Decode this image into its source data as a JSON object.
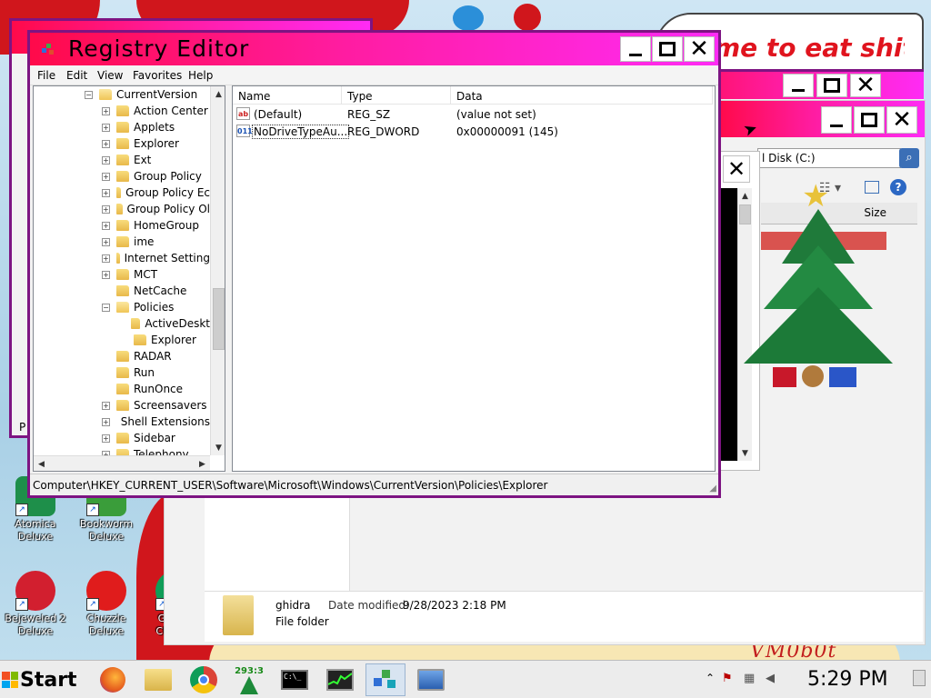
{
  "desktop": {
    "speech_text": "me to eat shit",
    "watermark": "VM0b0t",
    "icons": [
      {
        "line1": "Atomica",
        "line2": "Deluxe"
      },
      {
        "line1": "Bookworm",
        "line2": "Deluxe"
      },
      {
        "line1": "Bejeweled 2",
        "line2": "Deluxe"
      },
      {
        "line1": "Chuzzle",
        "line2": "Deluxe"
      },
      {
        "line1": "Google",
        "line2": "Chrome"
      }
    ]
  },
  "explorer": {
    "address": "l Disk (C:)",
    "column_size": "Size",
    "status_name": "ghidra",
    "status_modified_label": "Date modified:",
    "status_modified_value": "9/28/2023 2:18 PM",
    "status_type": "File folder",
    "left_letter": "P"
  },
  "regedit": {
    "title": "Registry Editor",
    "menu": [
      "File",
      "Edit",
      "View",
      "Favorites",
      "Help"
    ],
    "tree": [
      {
        "label": "CurrentVersion",
        "expander": "−",
        "level": 0
      },
      {
        "label": "Action Center",
        "expander": "+",
        "level": 1
      },
      {
        "label": "Applets",
        "expander": "+",
        "level": 1
      },
      {
        "label": "Explorer",
        "expander": "+",
        "level": 1
      },
      {
        "label": "Ext",
        "expander": "+",
        "level": 1
      },
      {
        "label": "Group Policy",
        "expander": "+",
        "level": 1
      },
      {
        "label": "Group Policy Ec",
        "expander": "+",
        "level": 1
      },
      {
        "label": "Group Policy Ol",
        "expander": "+",
        "level": 1
      },
      {
        "label": "HomeGroup",
        "expander": "+",
        "level": 1
      },
      {
        "label": "ime",
        "expander": "+",
        "level": 1
      },
      {
        "label": "Internet Setting",
        "expander": "+",
        "level": 1
      },
      {
        "label": "MCT",
        "expander": "+",
        "level": 1
      },
      {
        "label": "NetCache",
        "expander": "",
        "level": 1
      },
      {
        "label": "Policies",
        "expander": "−",
        "level": 1
      },
      {
        "label": "ActiveDeskt",
        "expander": "",
        "level": 2
      },
      {
        "label": "Explorer",
        "expander": "",
        "level": 2
      },
      {
        "label": "RADAR",
        "expander": "",
        "level": 1
      },
      {
        "label": "Run",
        "expander": "",
        "level": 1
      },
      {
        "label": "RunOnce",
        "expander": "",
        "level": 1
      },
      {
        "label": "Screensavers",
        "expander": "+",
        "level": 1
      },
      {
        "label": "Shell Extensions",
        "expander": "+",
        "level": 1
      },
      {
        "label": "Sidebar",
        "expander": "+",
        "level": 1
      },
      {
        "label": "Telephony",
        "expander": "+",
        "level": 1
      }
    ],
    "columns": {
      "name": "Name",
      "type": "Type",
      "data": "Data"
    },
    "values": [
      {
        "icon": "ab",
        "name": "(Default)",
        "type": "REG_SZ",
        "data": "(value not set)"
      },
      {
        "icon": "011",
        "name": "NoDriveTypeAu...",
        "type": "REG_DWORD",
        "data": "0x00000091 (145)"
      }
    ],
    "status_path": "Computer\\HKEY_CURRENT_USER\\Software\\Microsoft\\Windows\\CurrentVersion\\Policies\\Explorer"
  },
  "taskbar": {
    "start_label": "Start",
    "net_meter": "293:3",
    "clock": "5:29 PM"
  },
  "colors": {
    "title_gradient_start": "#ff0a4a",
    "title_gradient_end": "#ff2bf5",
    "window_border": "#7d1482",
    "speech_text": "#e0141e"
  }
}
